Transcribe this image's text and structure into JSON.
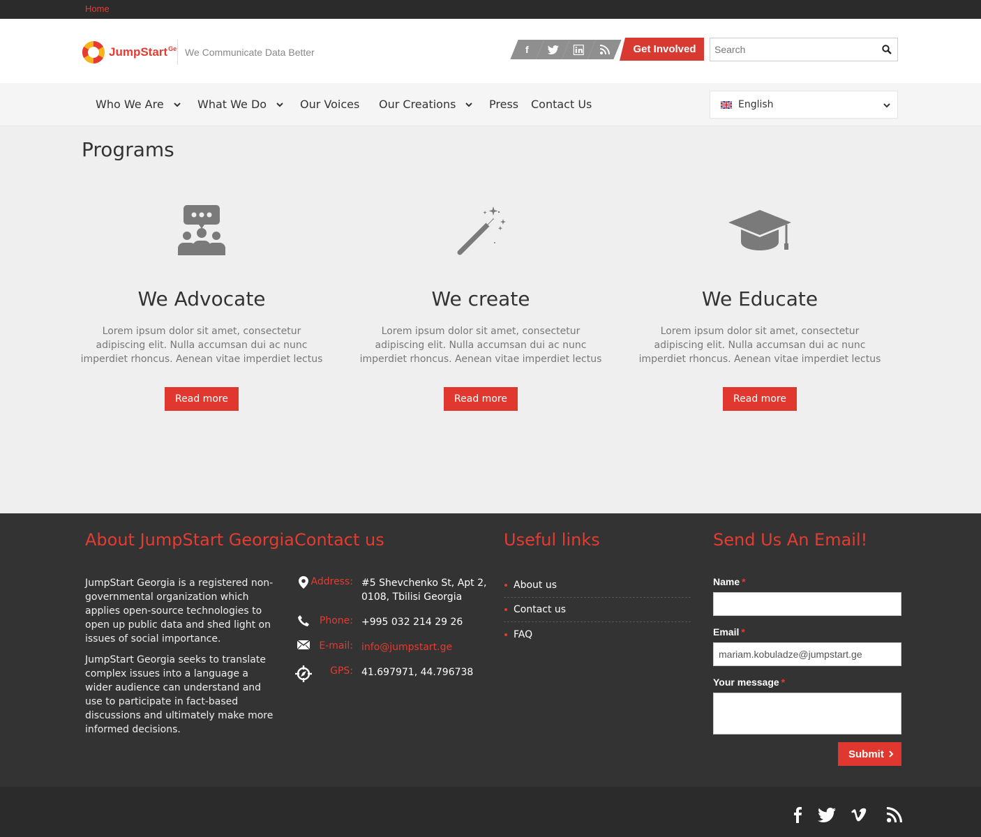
{
  "breadcrumb": {
    "home": "Home"
  },
  "header": {
    "logo_text": "JumpStart",
    "logo_sup": "Ge",
    "tagline": "We Communicate Data Better",
    "social_icons": [
      "facebook-icon",
      "twitter-icon",
      "linkedin-icon",
      "rss-icon"
    ],
    "cta_label": "Get Involved",
    "search_placeholder": "Search"
  },
  "nav": {
    "items": [
      {
        "label": "Who We Are",
        "has_dropdown": true
      },
      {
        "label": "What We Do",
        "has_dropdown": true
      },
      {
        "label": "Our Voices",
        "has_dropdown": false
      },
      {
        "label": "Our Creations",
        "has_dropdown": true
      },
      {
        "label": "Press",
        "has_dropdown": false
      },
      {
        "label": "Contact Us",
        "has_dropdown": false
      }
    ],
    "language": "English"
  },
  "main": {
    "title": "Programs",
    "programs": [
      {
        "icon": "people-chat-icon",
        "title": "We Advocate",
        "text": "Lorem ipsum dolor sit amet, consectetur adipiscing elit. Nulla accumsan dui ac nunc imperdiet rhoncus. Aenean vitae imperdiet lectus",
        "button": "Read more"
      },
      {
        "icon": "magic-wand-icon",
        "title": "We create",
        "text": "Lorem ipsum dolor sit amet, consectetur adipiscing elit. Nulla accumsan dui ac nunc imperdiet rhoncus. Aenean vitae imperdiet lectus",
        "button": "Read more"
      },
      {
        "icon": "graduation-cap-icon",
        "title": "We Educate",
        "text": "Lorem ipsum dolor sit amet, consectetur adipiscing elit. Nulla accumsan dui ac nunc imperdiet rhoncus. Aenean vitae imperdiet lectus",
        "button": "Read more"
      }
    ]
  },
  "footer": {
    "about": {
      "title": "About JumpStart Georgia",
      "p1": "JumpStart Georgia is a registered non-governmental organization which applies open-source technologies to open up public data and shed light on issues of social importance.",
      "p2": "JumpStart Georgia seeks to translate complex issues into a language a wider audience can understand and use to participate in fact-based discussions and ultimately make more informed decisions."
    },
    "contact": {
      "title": "Contact us",
      "address_label": "Address:",
      "address": "#5 Shevchenko St, Apt 2, 0108, Tbilisi Georgia",
      "phone_label": "Phone:",
      "phone": "+995 032 214 29 26",
      "email_label": "E-mail:",
      "email": "info@jumpstart.ge",
      "gps_label": "GPS:",
      "gps": "41.697971, 44.796738"
    },
    "links": {
      "title": "Useful links",
      "items": [
        "About us",
        "Contact us",
        "FAQ"
      ]
    },
    "form": {
      "title": "Send Us An Email!",
      "name_label": "Name",
      "name_value": "",
      "email_label": "Email",
      "email_value": "mariam.kobuladze@jumpstart.ge",
      "message_label": "Your message",
      "message_value": "",
      "required_mark": "*",
      "submit": "Submit"
    },
    "bottom_social_icons": [
      "facebook-icon",
      "twitter-icon",
      "vimeo-icon",
      "rss-icon"
    ]
  },
  "colors": {
    "accent": "#e0382f",
    "dark": "#333333",
    "darker": "#2b2b2b",
    "icon_gray": "#7a7a7a"
  }
}
